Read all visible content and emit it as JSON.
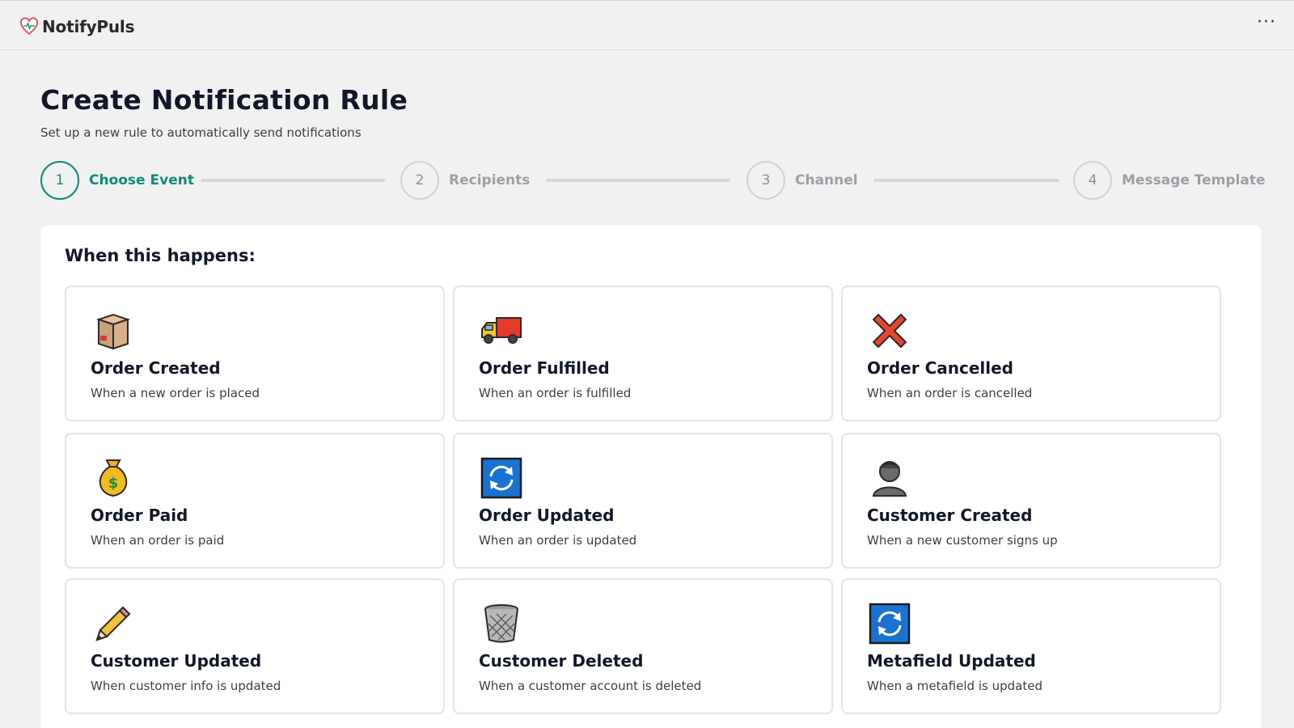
{
  "app": {
    "name": "NotifyPuls",
    "more_label": "···"
  },
  "page": {
    "title": "Create Notification Rule",
    "subtitle": "Set up a new rule to automatically send notifications"
  },
  "steps": [
    {
      "number": "1",
      "label": "Choose Event",
      "active": true
    },
    {
      "number": "2",
      "label": "Recipients",
      "active": false
    },
    {
      "number": "3",
      "label": "Channel",
      "active": false
    },
    {
      "number": "4",
      "label": "Message Template",
      "active": false
    }
  ],
  "colors": {
    "accent": "#0f8a78",
    "inactive": "#9aa0a6",
    "background": "#f1f1f1"
  },
  "events": {
    "heading": "When this happens:",
    "items": [
      {
        "icon": "package-icon",
        "title": "Order Created",
        "description": "When a new order is placed"
      },
      {
        "icon": "truck-icon",
        "title": "Order Fulfilled",
        "description": "When an order is fulfilled"
      },
      {
        "icon": "cross-mark-icon",
        "title": "Order Cancelled",
        "description": "When an order is cancelled"
      },
      {
        "icon": "money-bag-icon",
        "title": "Order Paid",
        "description": "When an order is paid"
      },
      {
        "icon": "refresh-icon",
        "title": "Order Updated",
        "description": "When an order is updated"
      },
      {
        "icon": "person-icon",
        "title": "Customer Created",
        "description": "When a new customer signs up"
      },
      {
        "icon": "pencil-icon",
        "title": "Customer Updated",
        "description": "When customer info is updated"
      },
      {
        "icon": "wastebasket-icon",
        "title": "Customer Deleted",
        "description": "When a customer account is deleted"
      },
      {
        "icon": "refresh-icon",
        "title": "Metafield Updated",
        "description": "When a metafield is updated"
      }
    ]
  }
}
